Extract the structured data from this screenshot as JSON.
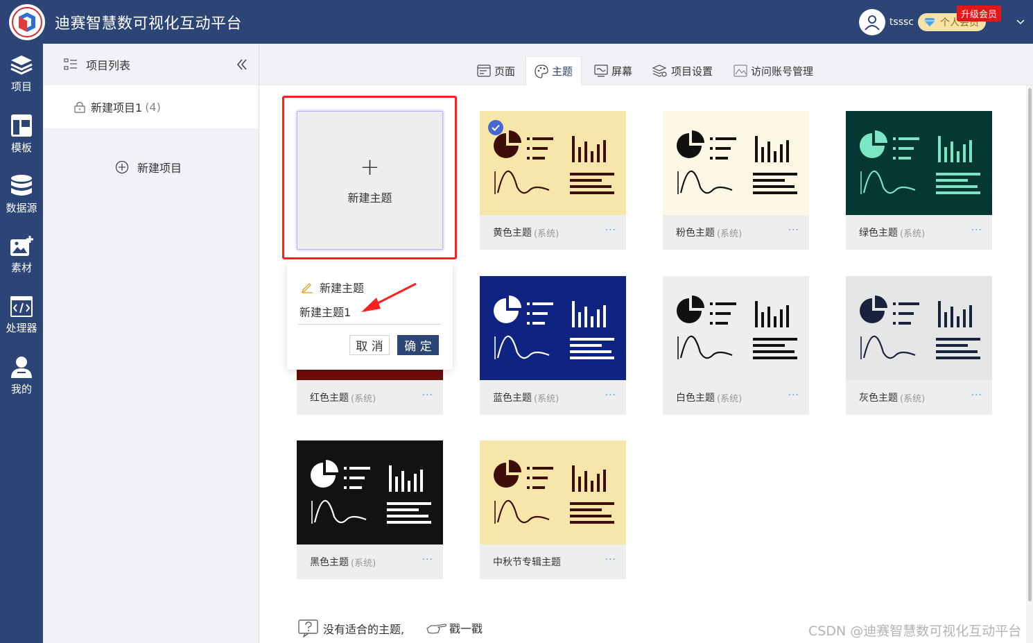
{
  "header": {
    "app_title": "迪赛智慧数可视化互动平台",
    "username": "tsssc",
    "vip_label": "个人会员",
    "upgrade_label": "升级会员"
  },
  "leftnav": {
    "items": [
      {
        "label": "项目",
        "icon": "layers-icon"
      },
      {
        "label": "模板",
        "icon": "template-icon"
      },
      {
        "label": "数据源",
        "icon": "database-icon"
      },
      {
        "label": "素材",
        "icon": "image-add-icon"
      },
      {
        "label": "处理器",
        "icon": "code-icon"
      },
      {
        "label": "我的",
        "icon": "user-icon"
      }
    ]
  },
  "project_panel": {
    "title": "项目列表",
    "project_name": "新建项目1",
    "project_count": "(4)",
    "new_project_label": "新建项目"
  },
  "tabs": [
    {
      "label": "页面",
      "icon": "page-icon"
    },
    {
      "label": "主题",
      "icon": "palette-icon"
    },
    {
      "label": "屏幕",
      "icon": "screen-icon"
    },
    {
      "label": "项目设置",
      "icon": "settings-icon"
    },
    {
      "label": "访问账号管理",
      "icon": "account-icon"
    }
  ],
  "new_theme_card": {
    "label": "新建主题"
  },
  "popover": {
    "title": "新建主题",
    "input_value": "新建主题1",
    "cancel_label": "取 消",
    "ok_label": "确 定"
  },
  "themes": [
    {
      "name": "黄色主题",
      "tag": "(系统)",
      "more": "···",
      "bg": "#f7e6a9",
      "fg": "#3d0d07",
      "selected": true
    },
    {
      "name": "粉色主题",
      "tag": "(系统)",
      "more": "···",
      "bg": "#fdf7e6",
      "fg": "#111111"
    },
    {
      "name": "绿色主题",
      "tag": "(系统)",
      "more": "···",
      "bg": "#053830",
      "fg": "#7be5c4"
    },
    {
      "name": "红色主题",
      "tag": "(系统)",
      "more": "···",
      "bg": "#6d0a0a",
      "fg": "#ffffff"
    },
    {
      "name": "蓝色主题",
      "tag": "(系统)",
      "more": "···",
      "bg": "#0f2382",
      "fg": "#ffffff"
    },
    {
      "name": "白色主题",
      "tag": "(系统)",
      "more": "···",
      "bg": "#eeeeee",
      "fg": "#111111"
    },
    {
      "name": "灰色主题",
      "tag": "(系统)",
      "more": "···",
      "bg": "#e6e6e6",
      "fg": "#17233d"
    },
    {
      "name": "黑色主题",
      "tag": "(系统)",
      "more": "···",
      "bg": "#121212",
      "fg": "#ffffff"
    },
    {
      "name": "中秋节专辑主题",
      "tag": "",
      "more": "···",
      "bg": "#f7e6a9",
      "fg": "#3d0d07"
    }
  ],
  "footer": {
    "help_text": "没有适合的主题,",
    "poke_text": "戳一戳",
    "watermark": "CSDN @迪赛智慧数可视化互动平台"
  }
}
